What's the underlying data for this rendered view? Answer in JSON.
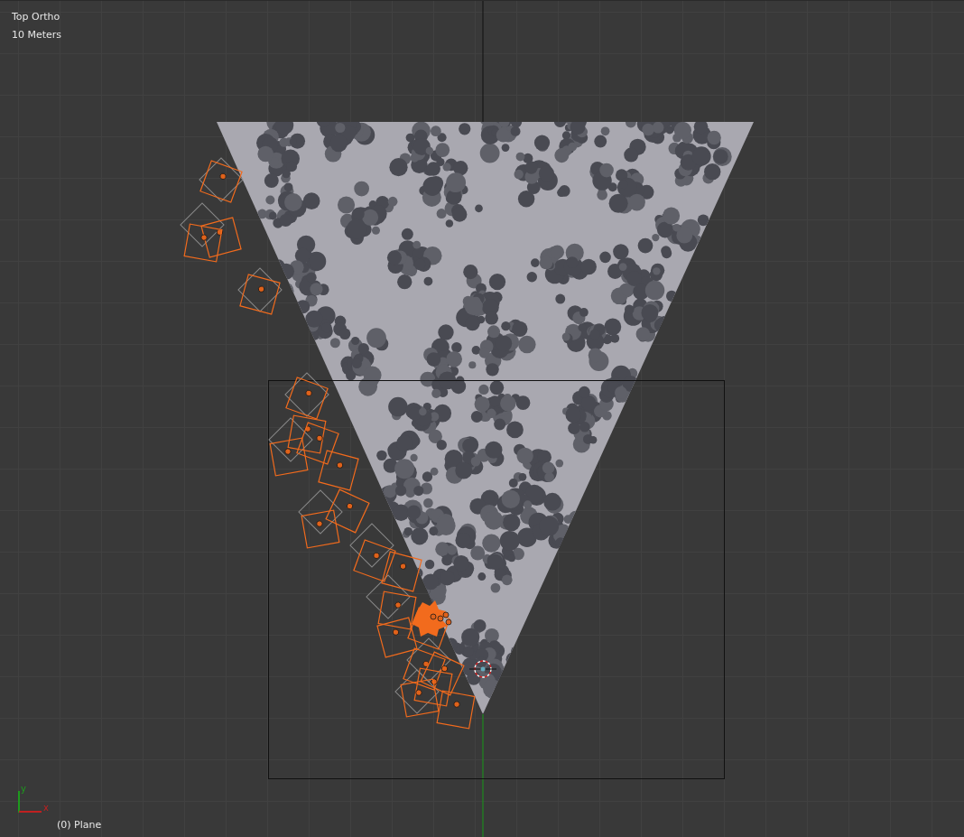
{
  "viewport": {
    "view_name": "Top Ortho",
    "scale": "10 Meters",
    "object_info": "(0) Plane"
  },
  "axis_gizmo": {
    "y_label": "y",
    "x_label": "x"
  }
}
